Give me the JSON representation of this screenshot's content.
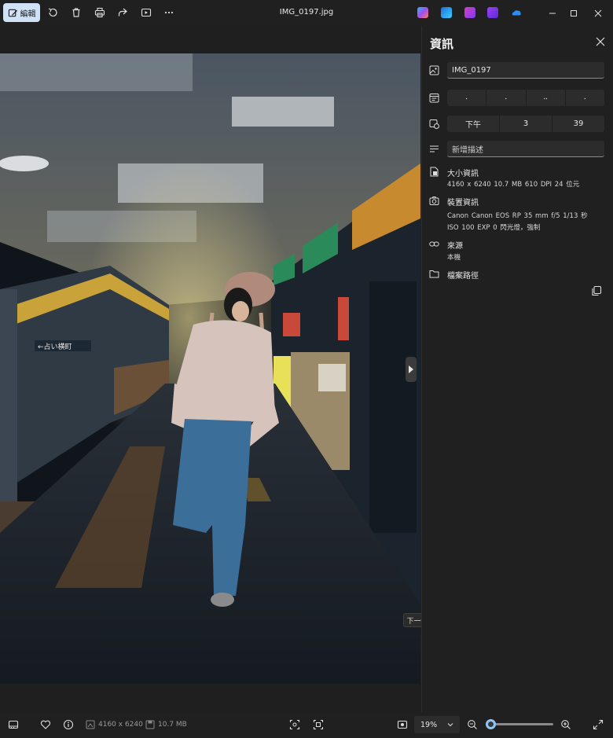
{
  "titlebar": {
    "edit_label": "編輯",
    "file_name": "IMG_0197.jpg",
    "icons": [
      "rotate-icon",
      "delete-icon",
      "print-icon",
      "share-icon",
      "slideshow-icon",
      "more-icon"
    ],
    "apps": [
      {
        "name": "copilot-icon",
        "color": "#7b5cf0"
      },
      {
        "name": "designer-icon",
        "color": "#3aa0ff"
      },
      {
        "name": "clipchamp-icon",
        "color": "#c23fd6"
      },
      {
        "name": "clipchamp2-icon",
        "color": "#8a3cf0"
      },
      {
        "name": "onedrive-icon",
        "color": "#2e8cf0"
      }
    ]
  },
  "photo": {
    "tooltip": "下一個"
  },
  "info_panel": {
    "title": "資訊",
    "file_name_value": "IMG_0197",
    "date_segments": [
      "⸱",
      "⸱",
      "⸱⸱",
      "⸱"
    ],
    "time_segments": [
      "下午",
      "3",
      "39"
    ],
    "description_placeholder": "新增描述",
    "size_label": "大小資訊",
    "size_details": "4160 x 6240   10.7 MB   610 DPI   24 位元",
    "device_label": "裝置資訊",
    "device_line1": "Canon   Canon EOS RP   35 mm   f/5   1/13 秒",
    "device_line2": "ISO 100   EXP 0   閃光燈，強制",
    "source_label": "來源",
    "source_value": "本機",
    "path_label": "檔案路徑"
  },
  "bottombar": {
    "dimensions": "4160 x 6240",
    "filesize": "10.7 MB",
    "zoom": "19%",
    "zoom_fraction": 0.19,
    "accent": "#8ec5f5"
  }
}
